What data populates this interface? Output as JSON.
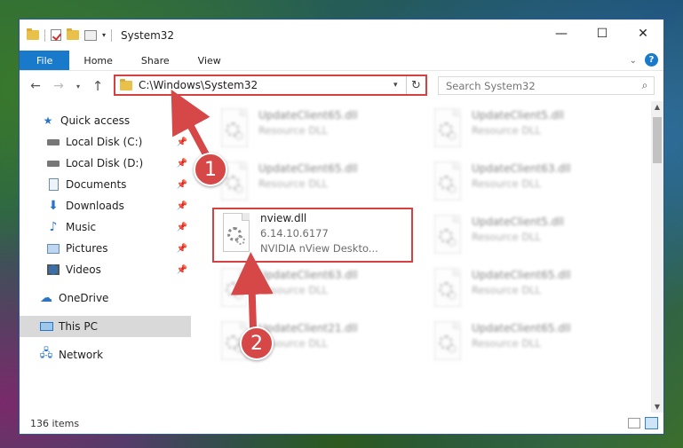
{
  "window": {
    "title": "System32",
    "controls": {
      "minimize": "—",
      "maximize": "☐",
      "close": "✕"
    }
  },
  "ribbon": {
    "tabs": [
      "File",
      "Home",
      "Share",
      "View"
    ],
    "help": "?"
  },
  "navbar": {
    "address": "C:\\Windows\\System32",
    "search_placeholder": "Search System32"
  },
  "sidebar": {
    "items": [
      {
        "label": "Quick access",
        "icon": "star-icon",
        "pinned": false
      },
      {
        "label": "Local Disk (C:)",
        "icon": "drive-icon",
        "pinned": true
      },
      {
        "label": "Local Disk (D:)",
        "icon": "drive-icon",
        "pinned": true
      },
      {
        "label": "Documents",
        "icon": "documents-icon",
        "pinned": true
      },
      {
        "label": "Downloads",
        "icon": "download-icon",
        "pinned": true
      },
      {
        "label": "Music",
        "icon": "music-icon",
        "pinned": true
      },
      {
        "label": "Pictures",
        "icon": "pictures-icon",
        "pinned": true
      },
      {
        "label": "Videos",
        "icon": "videos-icon",
        "pinned": true
      },
      {
        "label": "OneDrive",
        "icon": "cloud-icon",
        "pinned": false
      },
      {
        "label": "This PC",
        "icon": "computer-icon",
        "pinned": false,
        "selected": true
      },
      {
        "label": "Network",
        "icon": "network-icon",
        "pinned": false
      }
    ]
  },
  "files": [
    {
      "name": "UpdateClient65.dll",
      "type": "Resource DLL",
      "blurred": true
    },
    {
      "name": "UpdateClient5.dll",
      "type": "Resource DLL",
      "blurred": true
    },
    {
      "name": "UpdateClient65.dll",
      "type": "Resource DLL",
      "blurred": true
    },
    {
      "name": "UpdateClient63.dll",
      "type": "Resource DLL",
      "blurred": true
    },
    {
      "name": "nview.dll",
      "version": "6.14.10.6177",
      "description": "NVIDIA nView Deskto...",
      "blurred": false,
      "highlighted": true
    },
    {
      "name": "UpdateClient5.dll",
      "type": "Resource DLL",
      "blurred": true
    },
    {
      "name": "UpdateClient63.dll",
      "type": "Resource DLL",
      "blurred": true
    },
    {
      "name": "UpdateClient65.dll",
      "type": "Resource DLL",
      "blurred": true
    },
    {
      "name": "UpdateClient21.dll",
      "type": "Resource DLL",
      "blurred": true
    },
    {
      "name": "UpdateClient65.dll",
      "type": "Resource DLL",
      "blurred": true
    }
  ],
  "status": {
    "item_count": "136 items"
  },
  "annotations": {
    "step1": "1",
    "step2": "2",
    "color": "#d64848"
  }
}
